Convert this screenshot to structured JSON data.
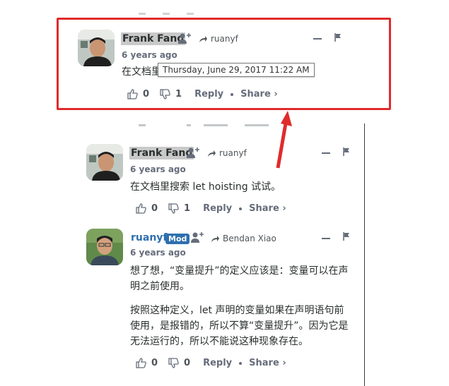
{
  "comments": [
    {
      "author": "Frank Fang",
      "reply_to": "ruanyf",
      "time": "6 years ago",
      "tooltip": "Thursday, June 29, 2017 11:22 AM",
      "body_visible": "在文档里",
      "upvotes": "0",
      "downvotes": "1",
      "reply_label": "Reply",
      "share_label": "Share ›"
    },
    {
      "author": "Frank Fang",
      "reply_to": "ruanyf",
      "time": "6 years ago",
      "body": "在文档里搜索 let hoisting 试试。",
      "upvotes": "0",
      "downvotes": "1",
      "reply_label": "Reply",
      "share_label": "Share ›"
    },
    {
      "author": "ruanyf",
      "badge": "Mod",
      "reply_to": "Bendan Xiao",
      "time": "6 years ago",
      "para1_line1": "想了想，“变量提升”的定义应该是：变量可以在声",
      "para1_line2": "明之前使用。",
      "para2_line1": "按照这种定义，let 声明的变量如果在声明语句前",
      "para2_line2": "使用，是报错的，所以不算“变量提升”。因为它是",
      "para2_line3": "无法运行的，所以不能说这种现象存在。",
      "upvotes": "0",
      "downvotes": "0",
      "reply_label": "Reply",
      "share_label": "Share ›"
    }
  ],
  "colors": {
    "highlight_box": "#e02b2b",
    "mod_blue": "#2e6faf",
    "meta_gray": "#656c7a"
  }
}
